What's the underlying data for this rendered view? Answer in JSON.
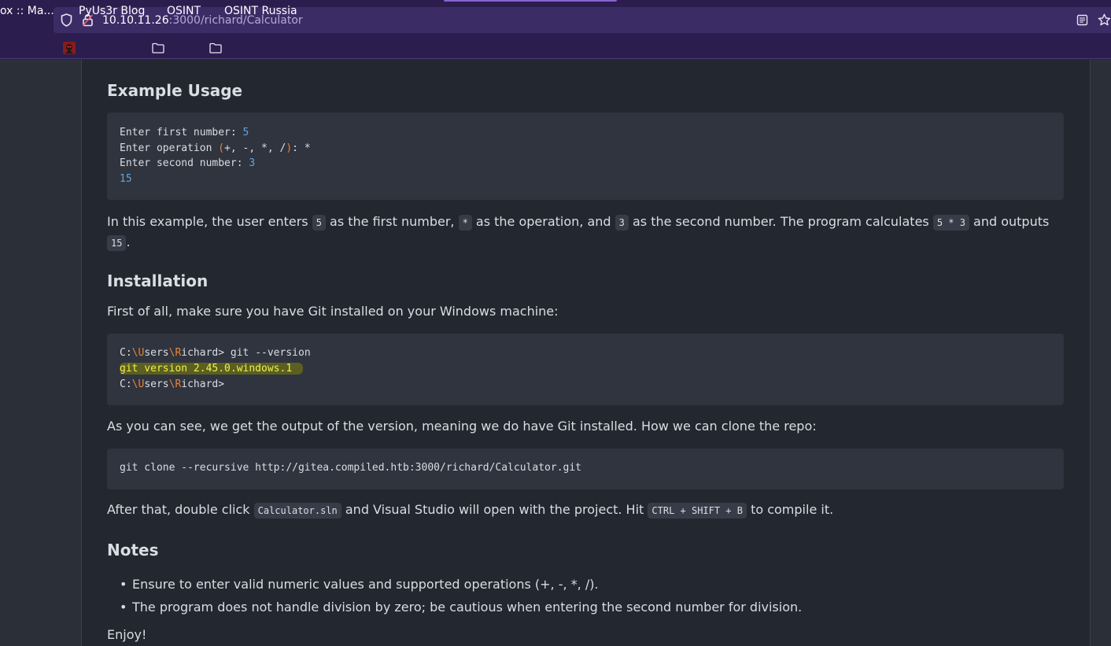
{
  "browser": {
    "url_host": "10.10.11.26",
    "url_path": ":3000/richard/Calculator",
    "bookmarks": [
      {
        "label": "ox :: Ma...",
        "icon": "none"
      },
      {
        "label": "PyUs3r Blog",
        "icon": "favicon"
      },
      {
        "label": "OSINT",
        "icon": "folder-icon"
      },
      {
        "label": "OSINT Russia",
        "icon": "folder-icon"
      }
    ]
  },
  "readme": {
    "example_heading": "Example Usage",
    "example_code": {
      "line1_label": "Enter first number: ",
      "line1_value": "5",
      "line2_label": "Enter operation ",
      "line2_open": "(",
      "line2_ops": "+, -, *, /",
      "line2_close": ")",
      "line2_rest": ": *",
      "line3_label": "Enter second number: ",
      "line3_value": "3",
      "line4_value": "15"
    },
    "example_text": {
      "t1": "In this example, the user enters ",
      "c1": "5",
      "t2": " as the first number, ",
      "c2": "*",
      "t3": " as the operation, and ",
      "c3": "3",
      "t4": " as the second number. The program calculates ",
      "c4": "5 * 3",
      "t5": " and outputs",
      "c5": "15",
      "t6": "."
    },
    "install_heading": "Installation",
    "install_intro": "First of all, make sure you have Git installed on your Windows machine:",
    "install_code": {
      "p1": "C:",
      "s1": "\\U",
      "p2": "sers",
      "s2": "\\R",
      "p3": "ichard> git --version",
      "line2": "git version 2.45.0.windows.1",
      "p4": "C:",
      "s3": "\\U",
      "p5": "sers",
      "s4": "\\R",
      "p6": "ichard>"
    },
    "clone_intro": "As you can see, we get the output of the version, meaning we do have Git installed. How we can clone the repo:",
    "clone_code": "git clone --recursive http://gitea.compiled.htb:3000/richard/Calculator.git",
    "after_text": {
      "t1": "After that, double click ",
      "c1": "Calculator.sln",
      "t2": " and Visual Studio will open with the project. Hit ",
      "c2": "CTRL + SHIFT + B",
      "t3": " to compile it."
    },
    "notes_heading": "Notes",
    "notes": [
      "Ensure to enter valid numeric values and supported operations (+, -, *, /).",
      "The program does not handle division by zero; be cautious when entering the second number for division."
    ],
    "closing": "Enjoy!"
  },
  "colors": {
    "chrome_bg": "#2b1d4e",
    "urlbar_bg": "#3b2c66",
    "page_bg": "#23272f",
    "code_bg": "#2f343e",
    "number_blue": "#61a3e0",
    "accent_orange": "#e8833a",
    "highlight_yellow": "#f0f04c"
  }
}
